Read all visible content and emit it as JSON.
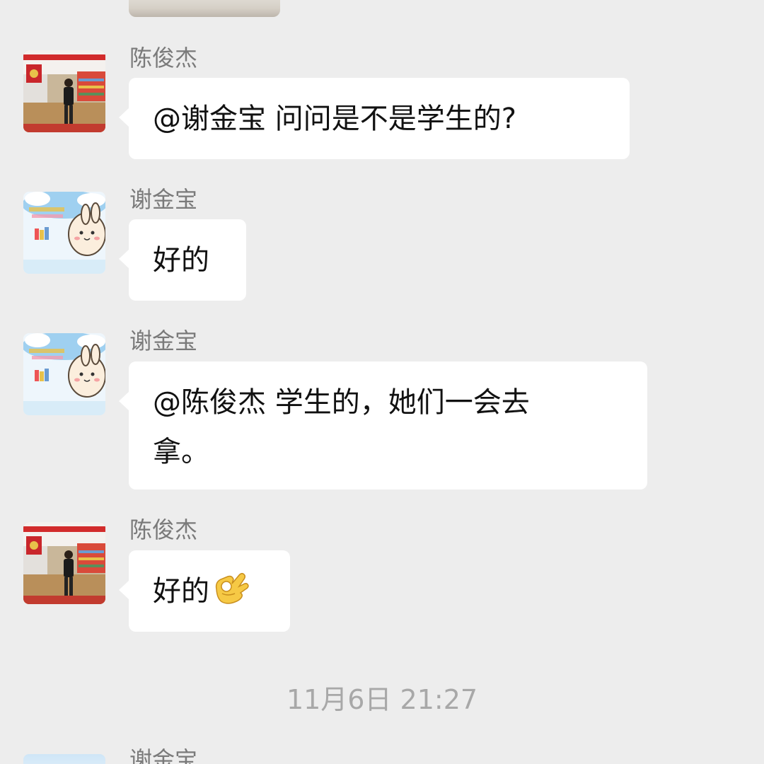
{
  "messages": [
    {
      "sender": "陈俊杰",
      "text": "@谢金宝 问问是不是学生的?"
    },
    {
      "sender": "谢金宝",
      "text": "好的"
    },
    {
      "sender": "谢金宝",
      "line1": "@陈俊杰 学生的，她们一会去",
      "line2": "拿。"
    },
    {
      "sender": "陈俊杰",
      "text": "好的",
      "emoji": "ok-hand-emoji"
    }
  ],
  "timestamp": "11月6日 21:27",
  "next_message": {
    "sender": "谢金宝"
  },
  "colors": {
    "background": "#ededed",
    "bubble": "#ffffff",
    "sender_name": "#7a7a7a",
    "timestamp": "#a8a8a8"
  }
}
